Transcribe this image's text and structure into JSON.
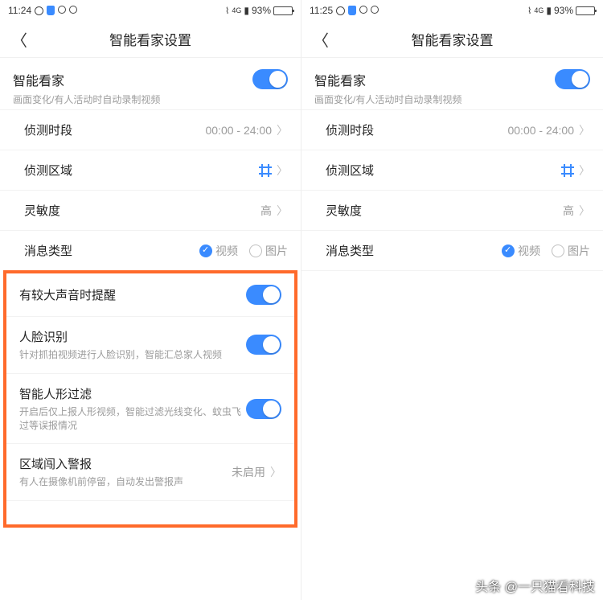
{
  "left": {
    "status": {
      "time": "11:24",
      "battery_pct": "93%",
      "net": "4G"
    },
    "title": "智能看家设置",
    "main": {
      "label": "智能看家",
      "desc": "画面变化/有人活动时自动录制视频",
      "toggle": true
    },
    "period": {
      "label": "侦测时段",
      "value": "00:00 - 24:00"
    },
    "area": {
      "label": "侦测区域"
    },
    "sensitivity": {
      "label": "灵敏度",
      "value": "高"
    },
    "msgtype": {
      "label": "消息类型",
      "opt1": "视频",
      "opt2": "图片"
    },
    "extra": {
      "sound": {
        "label": "有较大声音时提醒"
      },
      "face": {
        "label": "人脸识别",
        "desc": "针对抓拍视频进行人脸识别，智能汇总家人视频"
      },
      "human": {
        "label": "智能人形过滤",
        "desc": "开启后仅上报人形视频，智能过滤光线变化、蚊虫飞过等误报情况"
      },
      "intrusion": {
        "label": "区域闯入警报",
        "desc": "有人在摄像机前停留，自动发出警报声",
        "value": "未启用"
      }
    }
  },
  "right": {
    "status": {
      "time": "11:25",
      "battery_pct": "93%",
      "net": "4G"
    },
    "title": "智能看家设置",
    "main": {
      "label": "智能看家",
      "desc": "画面变化/有人活动时自动录制视频",
      "toggle": true
    },
    "period": {
      "label": "侦测时段",
      "value": "00:00 - 24:00"
    },
    "area": {
      "label": "侦测区域"
    },
    "sensitivity": {
      "label": "灵敏度",
      "value": "高"
    },
    "msgtype": {
      "label": "消息类型",
      "opt1": "视频",
      "opt2": "图片"
    }
  },
  "watermark": "头条 @一只猫看科技"
}
